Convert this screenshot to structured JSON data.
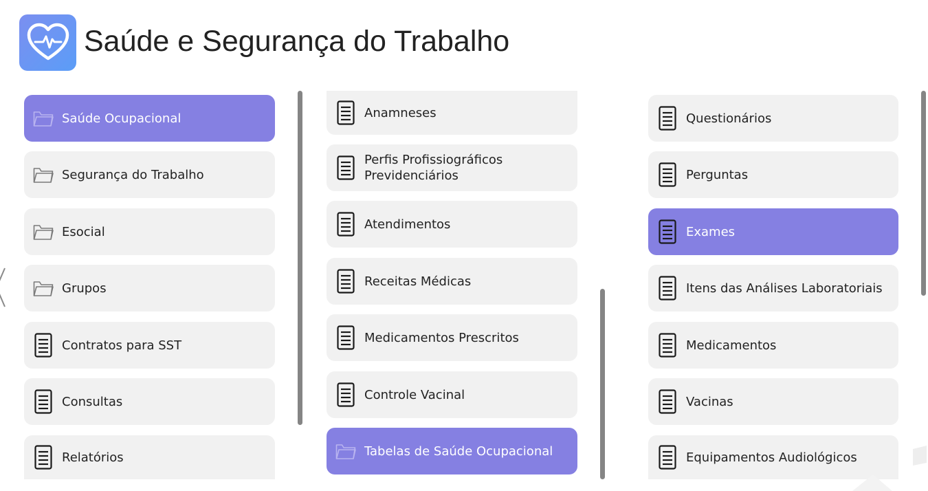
{
  "header": {
    "title": "Saúde e Segurança do Trabalho",
    "logo_icon": "heart-pulse-icon",
    "logo_color": "#6a95f4"
  },
  "colors": {
    "active": "#8580e2",
    "item_bg": "#f1f1f1",
    "scrollbar": "#858585"
  },
  "columns": [
    {
      "items": [
        {
          "label": "Saúde Ocupacional",
          "icon": "folder-icon",
          "active": true
        },
        {
          "label": "Segurança do Trabalho",
          "icon": "folder-icon",
          "active": false
        },
        {
          "label": "Esocial",
          "icon": "folder-icon",
          "active": false
        },
        {
          "label": "Grupos",
          "icon": "folder-icon",
          "active": false
        },
        {
          "label": "Contratos para SST",
          "icon": "document-icon",
          "active": false
        },
        {
          "label": "Consultas",
          "icon": "document-icon",
          "active": false
        },
        {
          "label": "Relatórios",
          "icon": "document-icon",
          "active": false
        }
      ]
    },
    {
      "items": [
        {
          "label": "Anamneses",
          "icon": "document-icon",
          "active": false
        },
        {
          "label": "Perfis Profissiográficos Previdenciários",
          "icon": "document-icon",
          "active": false
        },
        {
          "label": "Atendimentos",
          "icon": "document-icon",
          "active": false
        },
        {
          "label": "Receitas Médicas",
          "icon": "document-icon",
          "active": false
        },
        {
          "label": "Medicamentos Prescritos",
          "icon": "document-icon",
          "active": false
        },
        {
          "label": "Controle Vacinal",
          "icon": "document-icon",
          "active": false
        },
        {
          "label": "Tabelas de Saúde Ocupacional",
          "icon": "folder-icon",
          "active": true
        }
      ]
    },
    {
      "items": [
        {
          "label": "Questionários",
          "icon": "document-icon",
          "active": false
        },
        {
          "label": "Perguntas",
          "icon": "document-icon",
          "active": false
        },
        {
          "label": "Exames",
          "icon": "document-icon",
          "active": true
        },
        {
          "label": "Itens das Análises Laboratoriais",
          "icon": "document-icon",
          "active": false
        },
        {
          "label": "Medicamentos",
          "icon": "document-icon",
          "active": false
        },
        {
          "label": "Vacinas",
          "icon": "document-icon",
          "active": false
        },
        {
          "label": "Equipamentos Audiológicos",
          "icon": "document-icon",
          "active": false
        }
      ]
    }
  ]
}
